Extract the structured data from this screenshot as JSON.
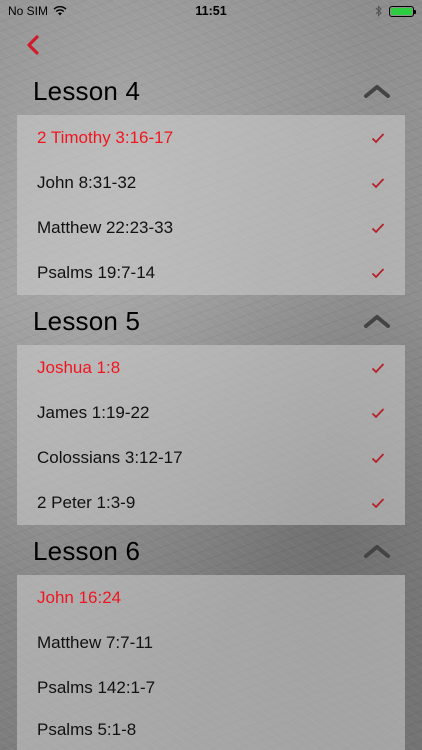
{
  "status_bar": {
    "carrier": "No SIM",
    "time": "11:51"
  },
  "colors": {
    "accent": "#f0161f",
    "check": "#b3212a",
    "battery": "#2ecc40"
  },
  "lessons": [
    {
      "title": "Lesson 4",
      "items": [
        {
          "label": "2 Timothy 3:16-17",
          "active": true,
          "checked": true
        },
        {
          "label": "John 8:31-32",
          "active": false,
          "checked": true
        },
        {
          "label": "Matthew 22:23-33",
          "active": false,
          "checked": true
        },
        {
          "label": "Psalms 19:7-14",
          "active": false,
          "checked": true
        }
      ]
    },
    {
      "title": "Lesson 5",
      "items": [
        {
          "label": "Joshua 1:8",
          "active": true,
          "checked": true
        },
        {
          "label": "James 1:19-22",
          "active": false,
          "checked": true
        },
        {
          "label": "Colossians 3:12-17",
          "active": false,
          "checked": true
        },
        {
          "label": "2 Peter 1:3-9",
          "active": false,
          "checked": true
        }
      ]
    },
    {
      "title": "Lesson 6",
      "items": [
        {
          "label": "John 16:24",
          "active": true,
          "checked": false
        },
        {
          "label": "Matthew 7:7-11",
          "active": false,
          "checked": false
        },
        {
          "label": "Psalms 142:1-7",
          "active": false,
          "checked": false
        },
        {
          "label": "Psalms 5:1-8",
          "active": false,
          "checked": false
        }
      ]
    }
  ]
}
